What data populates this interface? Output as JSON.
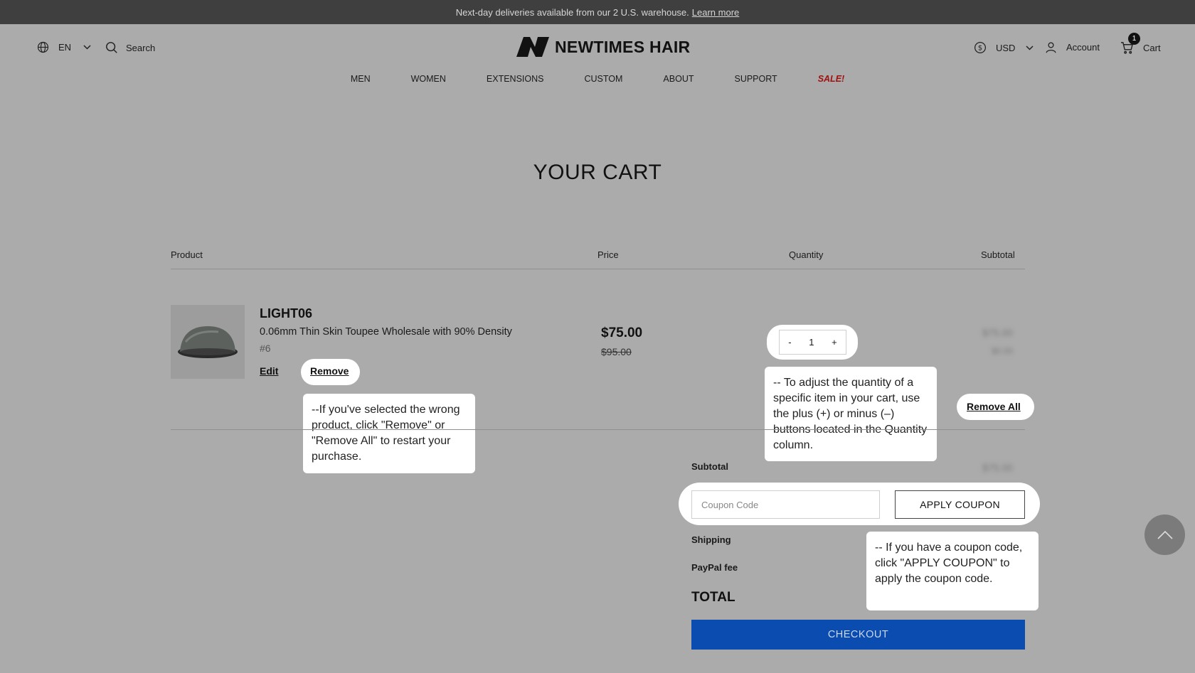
{
  "announcement": {
    "text": "Next-day deliveries available from our 2 U.S. warehouse.",
    "link": "Learn more"
  },
  "header": {
    "language": "EN",
    "search_label": "Search",
    "brand": "NEWTIMES HAIR",
    "currency": "USD",
    "account_label": "Account",
    "cart_label": "Cart",
    "cart_count": "1"
  },
  "nav": [
    "MEN",
    "WOMEN",
    "EXTENSIONS",
    "CUSTOM",
    "ABOUT",
    "SUPPORT",
    "SALE!"
  ],
  "cart": {
    "title": "YOUR CART",
    "columns": {
      "product": "Product",
      "price": "Price",
      "quantity": "Quantity",
      "subtotal": "Subtotal"
    },
    "item": {
      "name": "LIGHT06",
      "description": "0.06mm Thin Skin Toupee Wholesale with 90% Density",
      "variant": "#6",
      "edit_label": "Edit",
      "remove_label": "Remove",
      "price": "$75.00",
      "original_price": "$95.00",
      "qty_minus": "-",
      "quantity": "1",
      "qty_plus": "+",
      "subtotal": "$75.00",
      "subtotal_sub": "$0.00"
    },
    "remove_all_label": "Remove All"
  },
  "summary": {
    "subtotal_label": "Subtotal",
    "subtotal_value": "$75.00",
    "coupon_placeholder": "Coupon Code",
    "apply_coupon_label": "APPLY COUPON",
    "shipping_label": "Shipping",
    "paypal_fee_label": "PayPal fee",
    "total_label": "TOTAL",
    "checkout_label": "CHECKOUT"
  },
  "tooltips": {
    "remove": "--If you've selected the wrong product, click \"Remove\" or \"Remove All\" to restart your purchase.",
    "quantity": "-- To adjust the quantity of a specific item in your cart, use the plus (+) or minus (–) buttons located in the Quantity column.",
    "coupon": "-- If you have a coupon code, click \"APPLY COUPON\" to apply the coupon code."
  }
}
